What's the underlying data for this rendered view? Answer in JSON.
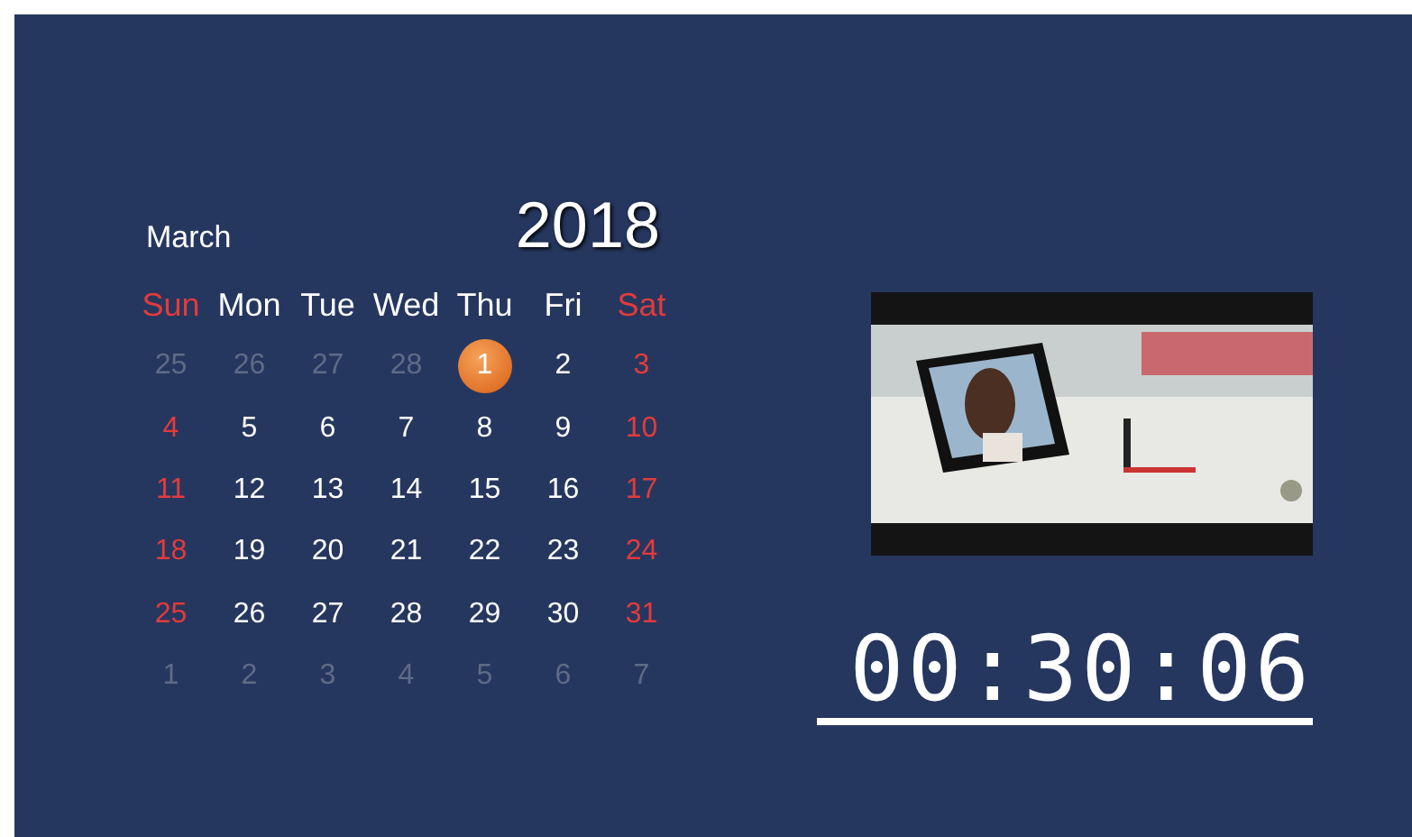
{
  "calendar": {
    "month": "March",
    "year": "2018",
    "weekdays": [
      {
        "label": "Sun",
        "weekend": true
      },
      {
        "label": "Mon",
        "weekend": false
      },
      {
        "label": "Tue",
        "weekend": false
      },
      {
        "label": "Wed",
        "weekend": false
      },
      {
        "label": "Thu",
        "weekend": false
      },
      {
        "label": "Fri",
        "weekend": false
      },
      {
        "label": "Sat",
        "weekend": true
      }
    ],
    "days": [
      {
        "label": "25",
        "kind": "adjacent",
        "selected": false
      },
      {
        "label": "26",
        "kind": "adjacent",
        "selected": false
      },
      {
        "label": "27",
        "kind": "adjacent",
        "selected": false
      },
      {
        "label": "28",
        "kind": "adjacent",
        "selected": false
      },
      {
        "label": "1",
        "kind": "weekday",
        "selected": true
      },
      {
        "label": "2",
        "kind": "weekday",
        "selected": false
      },
      {
        "label": "3",
        "kind": "weekend",
        "selected": false
      },
      {
        "label": "4",
        "kind": "weekend",
        "selected": false
      },
      {
        "label": "5",
        "kind": "weekday",
        "selected": false
      },
      {
        "label": "6",
        "kind": "weekday",
        "selected": false
      },
      {
        "label": "7",
        "kind": "weekday",
        "selected": false
      },
      {
        "label": "8",
        "kind": "weekday",
        "selected": false
      },
      {
        "label": "9",
        "kind": "weekday",
        "selected": false
      },
      {
        "label": "10",
        "kind": "weekend",
        "selected": false
      },
      {
        "label": "11",
        "kind": "weekend",
        "selected": false
      },
      {
        "label": "12",
        "kind": "weekday",
        "selected": false
      },
      {
        "label": "13",
        "kind": "weekday",
        "selected": false
      },
      {
        "label": "14",
        "kind": "weekday",
        "selected": false
      },
      {
        "label": "15",
        "kind": "weekday",
        "selected": false
      },
      {
        "label": "16",
        "kind": "weekday",
        "selected": false
      },
      {
        "label": "17",
        "kind": "weekend",
        "selected": false
      },
      {
        "label": "18",
        "kind": "weekend",
        "selected": false
      },
      {
        "label": "19",
        "kind": "weekday",
        "selected": false
      },
      {
        "label": "20",
        "kind": "weekday",
        "selected": false
      },
      {
        "label": "21",
        "kind": "weekday",
        "selected": false
      },
      {
        "label": "22",
        "kind": "weekday",
        "selected": false
      },
      {
        "label": "23",
        "kind": "weekday",
        "selected": false
      },
      {
        "label": "24",
        "kind": "weekend",
        "selected": false
      },
      {
        "label": "25",
        "kind": "weekend",
        "selected": false
      },
      {
        "label": "26",
        "kind": "weekday",
        "selected": false
      },
      {
        "label": "27",
        "kind": "weekday",
        "selected": false
      },
      {
        "label": "28",
        "kind": "weekday",
        "selected": false
      },
      {
        "label": "29",
        "kind": "weekday",
        "selected": false
      },
      {
        "label": "30",
        "kind": "weekday",
        "selected": false
      },
      {
        "label": "31",
        "kind": "weekend",
        "selected": false
      },
      {
        "label": "1",
        "kind": "adjacent",
        "selected": false
      },
      {
        "label": "2",
        "kind": "adjacent",
        "selected": false
      },
      {
        "label": "3",
        "kind": "adjacent",
        "selected": false
      },
      {
        "label": "4",
        "kind": "adjacent",
        "selected": false
      },
      {
        "label": "5",
        "kind": "adjacent",
        "selected": false
      },
      {
        "label": "6",
        "kind": "adjacent",
        "selected": false
      },
      {
        "label": "7",
        "kind": "adjacent",
        "selected": false
      }
    ]
  },
  "clock": {
    "time": "00:30:06"
  }
}
